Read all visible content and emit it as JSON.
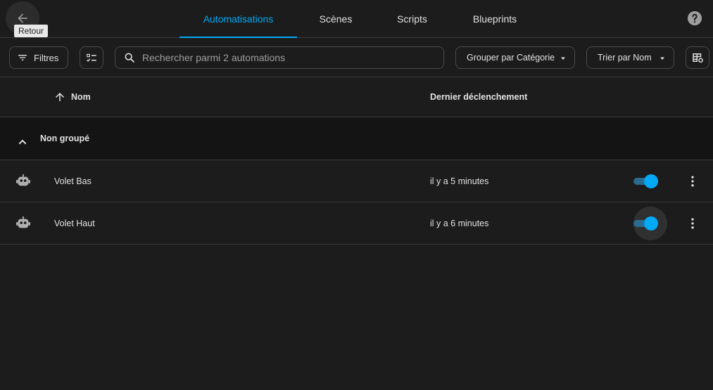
{
  "header": {
    "back_tooltip": "Retour",
    "tabs": [
      {
        "label": "Automatisations",
        "active": true
      },
      {
        "label": "Scènes",
        "active": false
      },
      {
        "label": "Scripts",
        "active": false
      },
      {
        "label": "Blueprints",
        "active": false
      }
    ]
  },
  "toolbar": {
    "filters_label": "Filtres",
    "search_placeholder": "Rechercher parmi 2 automations",
    "group_by_label": "Grouper par Catégorie",
    "sort_by_label": "Trier par Nom"
  },
  "table": {
    "columns": {
      "name": "Nom",
      "last_triggered": "Dernier déclenchement"
    },
    "group_label": "Non groupé",
    "rows": [
      {
        "name": "Volet Bas",
        "last_triggered": "il y a 5 minutes",
        "enabled": true
      },
      {
        "name": "Volet Haut",
        "last_triggered": "il y a 6 minutes",
        "enabled": true
      }
    ]
  },
  "colors": {
    "accent": "#03a9f4",
    "background": "#1c1c1c",
    "group_background": "#141414",
    "text": "#e1e1e1",
    "divider": "#3a3a3a"
  },
  "icons": {
    "back": "arrow-left-icon",
    "help": "help-circle-icon",
    "filters": "filter-icon",
    "selection": "checklist-icon",
    "search": "search-icon",
    "dropdown": "caret-down-icon",
    "settings": "table-settings-icon",
    "sort": "arrow-up-icon",
    "group_toggle": "chevron-up-icon",
    "automation": "robot-icon",
    "more": "dots-vertical-icon"
  }
}
